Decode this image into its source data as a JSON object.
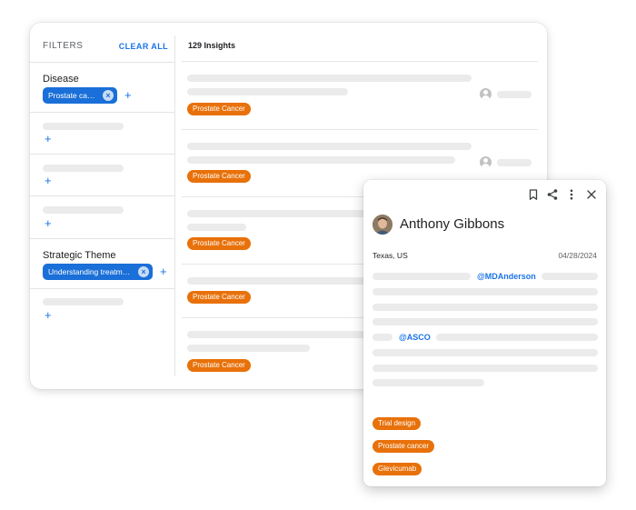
{
  "filters": {
    "title": "FILTERS",
    "clear_all": "CLEAR ALL",
    "groups": [
      {
        "label": "Disease",
        "chip": "Prostate cancer"
      },
      {
        "label": "Strategic Theme",
        "chip": "Understanding treatment..."
      }
    ]
  },
  "insights": {
    "count_label": "129 Insights",
    "items": [
      {
        "tag": "Prostate Cancer"
      },
      {
        "tag": "Prostate Cancer"
      },
      {
        "tag": "Prostate Cancer"
      },
      {
        "tag": "Prostate Cancer"
      },
      {
        "tag": "Prostate Cancer"
      }
    ]
  },
  "detail": {
    "name": "Anthony Gibbons",
    "location": "Texas, US",
    "date": "04/28/2024",
    "mentions": [
      "@MDAnderson",
      "@ASCO"
    ],
    "tags": [
      "Trial design",
      "Prostate cancer",
      "Glevicumab"
    ]
  },
  "colors": {
    "accent_blue": "#1a73e8",
    "chip_blue": "#1a6fd8",
    "tag_orange": "#e8710a",
    "placeholder": "#ebebeb"
  },
  "icons": [
    "close-circle-icon",
    "plus-icon",
    "bookmark-icon",
    "share-icon",
    "more-vert-icon",
    "close-icon",
    "user-icon",
    "avatar-photo"
  ]
}
